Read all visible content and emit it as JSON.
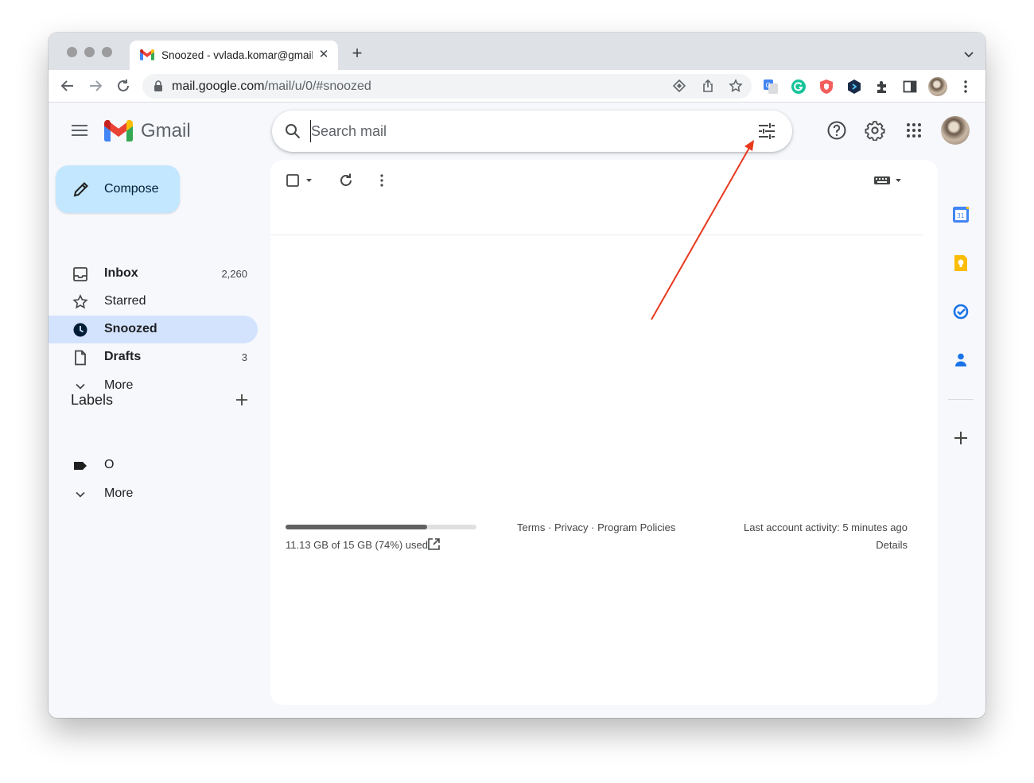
{
  "browser": {
    "tab_title": "Snoozed - vvlada.komar@gmail.com - Gmail",
    "tab_close": "✕",
    "new_tab": "+",
    "url_domain": "mail.google.com",
    "url_path": "/mail/u/0/#snoozed"
  },
  "gmail": {
    "brand": "Gmail",
    "search": {
      "placeholder": "Search mail"
    },
    "compose_label": "Compose",
    "nav": [
      {
        "label": "Inbox",
        "count": "2,260"
      },
      {
        "label": "Starred",
        "count": ""
      },
      {
        "label": "Snoozed",
        "count": ""
      },
      {
        "label": "Drafts",
        "count": "3"
      },
      {
        "label": "More",
        "count": ""
      }
    ],
    "labels_title": "Labels",
    "labels": [
      {
        "label": "O"
      },
      {
        "label": "More"
      }
    ],
    "footer": {
      "storage_text": "11.13 GB of 15 GB (74%) used",
      "storage_fraction": 0.74,
      "links": "Terms · Privacy · Program Policies",
      "activity": "Last account activity: 5 minutes ago",
      "details": "Details"
    }
  },
  "colors": {
    "accent_active": "#d3e3fd",
    "compose_bg": "#c2e7ff",
    "annotation_arrow": "#e8391f",
    "gmail_red": "#ea4335",
    "gmail_blue": "#4285f4",
    "gmail_green": "#34a853",
    "gmail_yellow": "#fbbc04"
  }
}
